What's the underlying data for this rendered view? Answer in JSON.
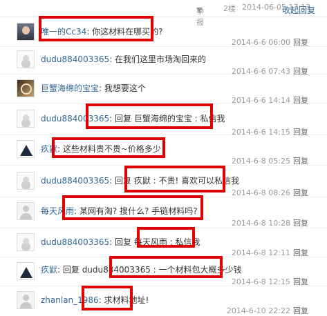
{
  "header": {
    "report_label": "举报",
    "report_arrow": "▼",
    "floor": "2楼",
    "datetime": "2014-06-05 17:13",
    "collapse_reply": "收起回复"
  },
  "reply_label": "回复",
  "comments": [
    {
      "avatar": "photo-avatar",
      "author": "唯一的Cc34",
      "prefix": "",
      "text": ": 你这材料在哪买的?",
      "time": "2014-6-6 06:00"
    },
    {
      "avatar": "snowman-avatar",
      "author": "dudu884003365",
      "prefix": "",
      "text": ": 在我们这里市场淘回来的",
      "time": "2014-6-6 07:43"
    },
    {
      "avatar": "character-avatar",
      "author": "巨蟹海绵的宝宝",
      "prefix": "",
      "text": ": 我想要这个",
      "time": "2014-6-6 14:14"
    },
    {
      "avatar": "snowman-avatar",
      "author": "dudu884003365",
      "prefix": "",
      "text": ": 回复 巨蟹海绵的宝宝 : 私信我",
      "time": "2014-6-6 14:15"
    },
    {
      "avatar": "dark-avatar",
      "author": "疚鼣",
      "prefix": "",
      "text": ": 这些材料贵不贵~价格多少",
      "time": "2014-6-8 05:25"
    },
    {
      "avatar": "snowman-avatar",
      "author": "dudu884003365",
      "prefix": "",
      "text": ": 回复 疚鼣 : 不贵! 喜欢可以私信我",
      "time": "2014-6-8 08:26"
    },
    {
      "avatar": "default-avatar",
      "author": "每天风雨",
      "prefix": "",
      "text": ": 某网有淘? 搜什么? 手链材料吗?",
      "time": "2014-6-8 10:28"
    },
    {
      "avatar": "snowman-avatar",
      "author": "dudu884003365",
      "prefix": "",
      "text": ": 回复 每天风雨 : 私信我",
      "time": "2014-6-8 12:11"
    },
    {
      "avatar": "dark-avatar",
      "author": "疚鼣",
      "prefix": "",
      "text": ": 回复 dudu884003365 : 一个材料包大概多少钱",
      "time": "2014-6-8 12:15"
    },
    {
      "avatar": "default-avatar",
      "author": "zhanlan_1986",
      "prefix": "",
      "text": ": 求材料地址!",
      "time": "2014-6-10 22:22"
    }
  ],
  "highlight_color": "#e00000"
}
